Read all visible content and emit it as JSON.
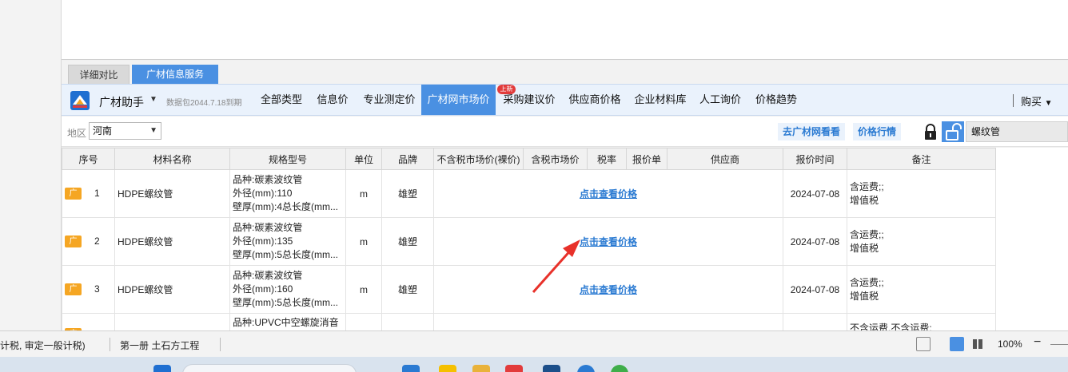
{
  "tabs": [
    {
      "label": "详细对比",
      "active": false
    },
    {
      "label": "广材信息服务",
      "active": true
    }
  ],
  "navbar": {
    "app_name": "广材助手",
    "data_version": "数据包2044.7.18到期",
    "items": [
      {
        "label": "全部类型",
        "active": false
      },
      {
        "label": "信息价",
        "active": false
      },
      {
        "label": "专业测定价",
        "active": false
      },
      {
        "label": "广材网市场价",
        "active": true
      },
      {
        "label": "采购建议价",
        "active": false,
        "badge": "上新"
      },
      {
        "label": "供应商价格",
        "active": false
      },
      {
        "label": "企业材料库",
        "active": false
      },
      {
        "label": "人工询价",
        "active": false
      },
      {
        "label": "价格趋势",
        "active": false
      }
    ],
    "buy_label": "购买"
  },
  "filter": {
    "region_label": "地区",
    "region_value": "河南",
    "goto_site": "去广材网看看",
    "price_market": "价格行情",
    "search_value": "螺纹管"
  },
  "table": {
    "columns": [
      "序号",
      "材料名称",
      "规格型号",
      "单位",
      "品牌",
      "不含税市场价(裸价)",
      "含税市场价",
      "税率",
      "报价单",
      "供应商",
      "报价时间",
      "备注"
    ],
    "tag_label": "广",
    "price_link": "点击查看价格",
    "rows": [
      {
        "index": "1",
        "name": "HDPE螺纹管",
        "spec1": "品种:碳素波纹管",
        "spec2": "外径(mm):110",
        "spec3": "壁厚(mm):4总长度(mm...",
        "unit": "m",
        "brand": "雄塑",
        "date": "2024-07-08",
        "note1": "含运费;;",
        "note2": "增值税"
      },
      {
        "index": "2",
        "name": "HDPE螺纹管",
        "spec1": "品种:碳素波纹管",
        "spec2": "外径(mm):135",
        "spec3": "壁厚(mm):5总长度(mm...",
        "unit": "m",
        "brand": "雄塑",
        "date": "2024-07-08",
        "note1": "含运费;;",
        "note2": "增值税"
      },
      {
        "index": "3",
        "name": "HDPE螺纹管",
        "spec1": "品种:碳素波纹管",
        "spec2": "外径(mm):160",
        "spec3": "壁厚(mm):5总长度(mm...",
        "unit": "m",
        "brand": "雄塑",
        "date": "2024-07-08",
        "note1": "含运费;;",
        "note2": "增值税"
      },
      {
        "index": "",
        "name": "",
        "spec1": "品种:UPVC中空螺旋消音",
        "spec2": "",
        "spec3": "",
        "unit": "",
        "brand": "",
        "date": "",
        "note1": "不含运费,不含运费;",
        "note2": ""
      }
    ]
  },
  "status": {
    "tax_mode": "计税, 审定一般计税)",
    "chapter": "第一册 土石方工程",
    "zoom": "100%"
  },
  "colors": {
    "accent": "#4a90e2",
    "link": "#2a7ad2",
    "tag": "#f5a623",
    "badge": "#e23b3b",
    "arrow": "#e8312a"
  }
}
